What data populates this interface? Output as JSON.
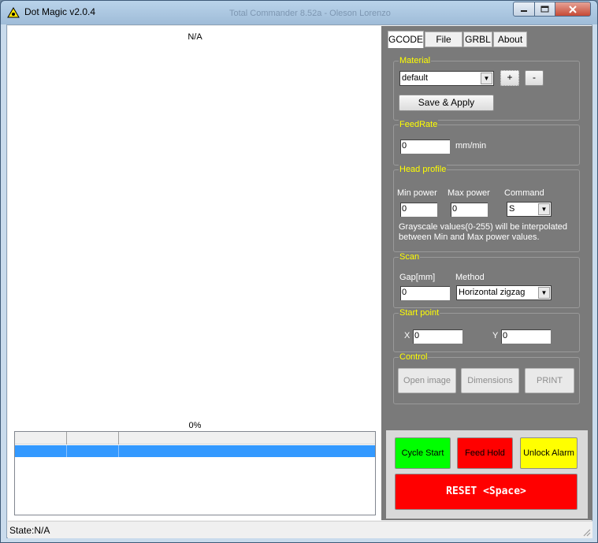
{
  "window": {
    "title": "Dot Magic v2.0.4",
    "background_title": "Total Commander 8.52a - Oleson Lorenzo"
  },
  "canvas": {
    "image_label": "N/A",
    "progress_label": "0%"
  },
  "tabs": [
    {
      "label": "GCODE",
      "active": true
    },
    {
      "label": "File",
      "active": false
    },
    {
      "label": "GRBL",
      "active": false
    },
    {
      "label": "About",
      "active": false
    }
  ],
  "material": {
    "title": "Material",
    "selected": "default",
    "add_label": "+",
    "remove_label": "-",
    "save_label": "Save & Apply"
  },
  "feedrate": {
    "title": "FeedRate",
    "value": "0",
    "unit": "mm/min"
  },
  "head_profile": {
    "title": "Head profile",
    "min_power_label": "Min power",
    "max_power_label": "Max power",
    "command_label": "Command",
    "min_power": "0",
    "max_power": "0",
    "command": "S",
    "note": "Grayscale values(0-255) will be interpolated between Min and Max power values."
  },
  "scan": {
    "title": "Scan",
    "gap_label": "Gap[mm]",
    "method_label": "Method",
    "gap": "0",
    "method": "Horizontal zigzag"
  },
  "start_point": {
    "title": "Start point",
    "x_label": "X",
    "y_label": "Y",
    "x": "0",
    "y": "0"
  },
  "control": {
    "title": "Control",
    "open_image": "Open image",
    "dimensions": "Dimensions",
    "print": "PRINT"
  },
  "actions": {
    "cycle_start": "Cycle Start",
    "feed_hold": "Feed Hold",
    "unlock_alarm": "Unlock Alarm",
    "reset": "RESET <Space>"
  },
  "colors": {
    "cycle_start": "#00ff00",
    "feed_hold": "#ff0000",
    "unlock_alarm": "#ffff00",
    "reset": "#ff0000",
    "group_title": "#ffff00",
    "panel": "#7a7a7a",
    "selection": "#3399ff"
  },
  "status": {
    "text": "State:N/A"
  }
}
